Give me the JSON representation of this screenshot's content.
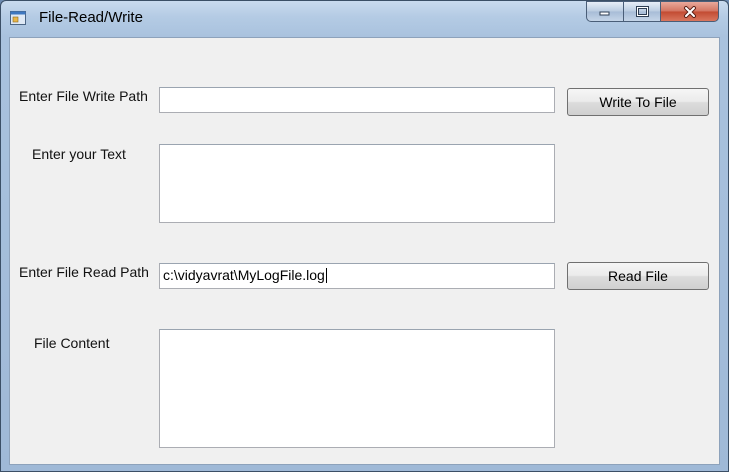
{
  "window": {
    "title": "File-Read/Write",
    "icon": "app-window-icon",
    "controls": [
      "minimize-icon",
      "maximize-icon",
      "close-icon"
    ]
  },
  "form": {
    "write_path_label": "Enter File Write Path",
    "write_path_value": "",
    "write_button": "Write To File",
    "text_label": "Enter your Text",
    "text_value": "",
    "read_path_label": "Enter File Read Path",
    "read_path_value": "c:\\vidyavrat\\MyLogFile.log",
    "read_button": "Read File",
    "content_label": "File Content",
    "content_value": ""
  }
}
